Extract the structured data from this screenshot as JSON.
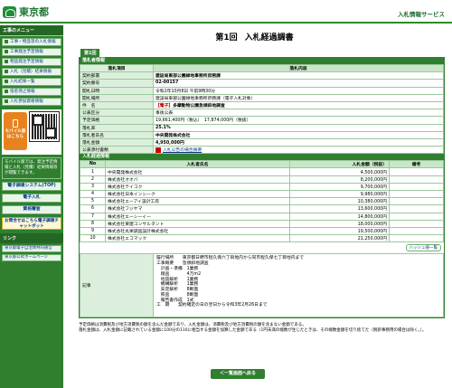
{
  "header": {
    "logo_text": "東京都",
    "service_title": "入札情報サービス"
  },
  "sidebar": {
    "heading": "工事のメニュー",
    "items": [
      "工事・物品等の入札情報",
      "工事発注予定情報",
      "物品発注予定情報",
      "入札（見積）結果情報",
      "入札結果一覧",
      "指名停止情報",
      "入札参加資格情報"
    ],
    "mobile_label": "モバイル版はこちら",
    "mobile_note": "モバイル版では、発注予定情報と入札（見積）結果情報等が閲覧できます。",
    "e_procure": "電子調達システム(TOP)",
    "e_bid": "電子入札",
    "qualification": "資格審査",
    "check_button": "お問合せはこちら電子調達チャットボット",
    "links_heading": "リンク",
    "links": [
      "東京都電子自治体共同運営",
      "東京都公式ホームページ"
    ]
  },
  "main": {
    "title_num": "第1回",
    "title_text": "入札経過調書",
    "tab_label": "第1回",
    "contract_section": "落札者情報",
    "col_item": "落札項目",
    "col_content": "落札内容",
    "rows": [
      {
        "k": "契約部署",
        "v": "建設局東部公園緑地事務所庶務課"
      },
      {
        "k": "契約番号",
        "v": "02-00157"
      },
      {
        "k": "開札日時",
        "v": "令和2年10月8日 午前9時30分"
      },
      {
        "k": "開札場所",
        "v": "建設局東部公園緑地事務所庶務課（電子入札対象）"
      },
      {
        "k": "件　名",
        "tag": "【電子】",
        "v": "多摩動物公園急傾斜地調査"
      },
      {
        "k": "公表区分",
        "v": "事後公表"
      },
      {
        "k": "予定価格",
        "v": "19,661,400円（税込）　17,874,000円（税抜）"
      },
      {
        "k": "落札率",
        "v": "25.1%"
      },
      {
        "k": "落札者氏名",
        "v": "中央開発株式会社"
      },
      {
        "k": "落札金額",
        "v": "4,950,000円"
      },
      {
        "k": "公表添付書類",
        "v": "入札公告の場合摘要"
      }
    ],
    "bid_section": "入札経過情報",
    "bid_headers": {
      "no": "No",
      "name": "入札者氏名",
      "amount": "入札金額（税抜）",
      "note": "備考"
    },
    "bids": [
      {
        "no": "1",
        "name": "中央開発株式会社",
        "amount": "4,500,000円"
      },
      {
        "no": "2",
        "name": "株式会社オオバ",
        "amount": "8,200,000円"
      },
      {
        "no": "3",
        "name": "株式会社テイコク",
        "amount": "9,700,000円"
      },
      {
        "no": "4",
        "name": "株式会社日本インシーク",
        "amount": "9,980,000円"
      },
      {
        "no": "5",
        "name": "株式会社エーアイ設計工房",
        "amount": "10,380,000円"
      },
      {
        "no": "6",
        "name": "株式会社フジヤマ",
        "amount": "13,600,000円"
      },
      {
        "no": "7",
        "name": "株式会社エーシーイー",
        "amount": "14,800,000円"
      },
      {
        "no": "8",
        "name": "株式会社東建コンサルタント",
        "amount": "18,000,000円"
      },
      {
        "no": "9",
        "name": "株式会社丸栄調査設計株式会社",
        "amount": "19,500,000円"
      },
      {
        "no": "10",
        "name": "株式会社エコマック",
        "amount": "21,250,000円"
      }
    ],
    "list_button": "ハッシュ値一覧",
    "remarks_label": "記事",
    "remarks": "履行場所　　東京都日野市程久保六丁目地内から同市程久保七丁目地内まで\n工事概要　　急傾斜地調査\n　計画・準備　1業務\n　踏査　　　　4万m2\n　地質解析　　1業務\n　機構解析　　1業務\n　安定解析　　8断面\n　照査　　　　8断面\n　報告書作成　1式\n工　期　　契約確定の日の翌日から令和3年2月26日まで",
    "footnote_1": "予定価格は消費税及び地方消費税の額を含んだ金額であり、入札金額は、消費税及び地方消費税の額を含まない金額である。",
    "footnote_2": "落札金額は、入札金額に記載されている金額に100分の110に相当する金額を加算した金額である（1円未満の端数が生じたときは、その端数金額を切り捨てた（税新事務用の場合は除く。）。",
    "back_button": "＜一覧画面へ戻る"
  }
}
